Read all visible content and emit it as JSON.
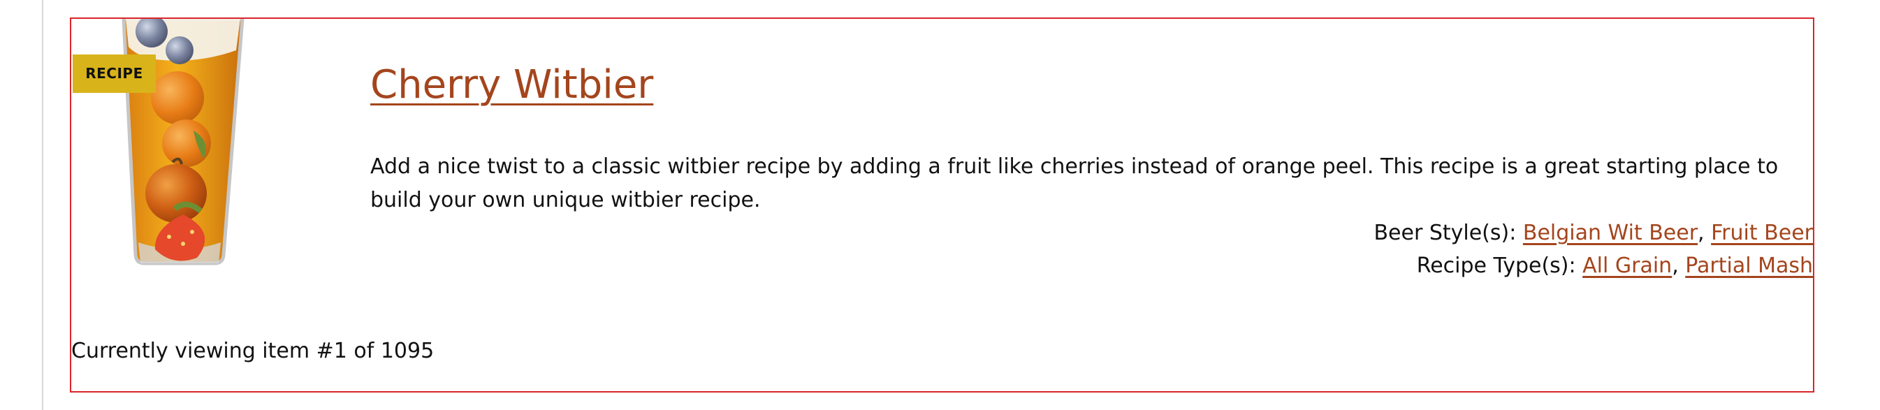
{
  "recipe": {
    "badge": "RECIPE",
    "title": "Cherry Witbier",
    "description": "Add a nice twist to a classic witbier recipe by adding a fruit like cherries instead of orange peel. This recipe is a great starting place to build your own unique witbier recipe.",
    "beer_styles_label": "Beer Style(s):",
    "beer_styles": [
      "Belgian Wit Beer",
      "Fruit Beer"
    ],
    "recipe_types_label": "Recipe Type(s):",
    "recipe_types": [
      "All Grain",
      "Partial Mash"
    ],
    "image_icon": "fruit-beer-glass-image"
  },
  "pagination": {
    "status": "Currently viewing item #1 of 1095"
  },
  "colors": {
    "link": "#a4451d",
    "badge": "#d9b31a",
    "card_border": "#d9252a"
  }
}
